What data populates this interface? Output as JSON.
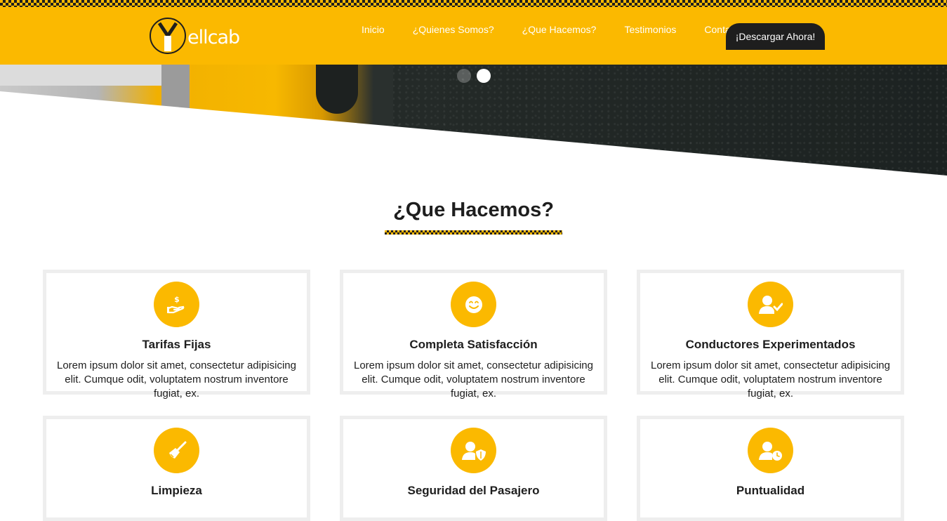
{
  "brand": {
    "logo_text": "ellcab",
    "logo_letter": "Y",
    "primary_color": "#fbb900",
    "dark_color": "#1e1e1e"
  },
  "nav": {
    "items": [
      {
        "label": "Inicio"
      },
      {
        "label": "¿Quienes Somos?"
      },
      {
        "label": "¿Que Hacemos?"
      },
      {
        "label": "Testimonios"
      },
      {
        "label": "Contacto"
      }
    ],
    "cta_label": "¡Descargar Ahora!"
  },
  "hero": {
    "slides": 2,
    "active_slide": 2
  },
  "section": {
    "title": "¿Que Hacemos?",
    "cards": [
      {
        "icon": "hand-money-icon",
        "title": "Tarifas Fijas",
        "text": "Lorem ipsum dolor sit amet, consectetur adipisicing elit. Cumque odit, voluptatem nostrum inventore fugiat, ex."
      },
      {
        "icon": "smile-icon",
        "title": "Completa Satisfacción",
        "text": "Lorem ipsum dolor sit amet, consectetur adipisicing elit. Cumque odit, voluptatem nostrum inventore fugiat, ex."
      },
      {
        "icon": "user-check-icon",
        "title": "Conductores Experimentados",
        "text": "Lorem ipsum dolor sit amet, consectetur adipisicing elit. Cumque odit, voluptatem nostrum inventore fugiat, ex."
      },
      {
        "icon": "broom-icon",
        "title": "Limpieza",
        "text": ""
      },
      {
        "icon": "user-shield-icon",
        "title": "Seguridad del Pasajero",
        "text": ""
      },
      {
        "icon": "user-clock-icon",
        "title": "Puntualidad",
        "text": ""
      }
    ]
  }
}
